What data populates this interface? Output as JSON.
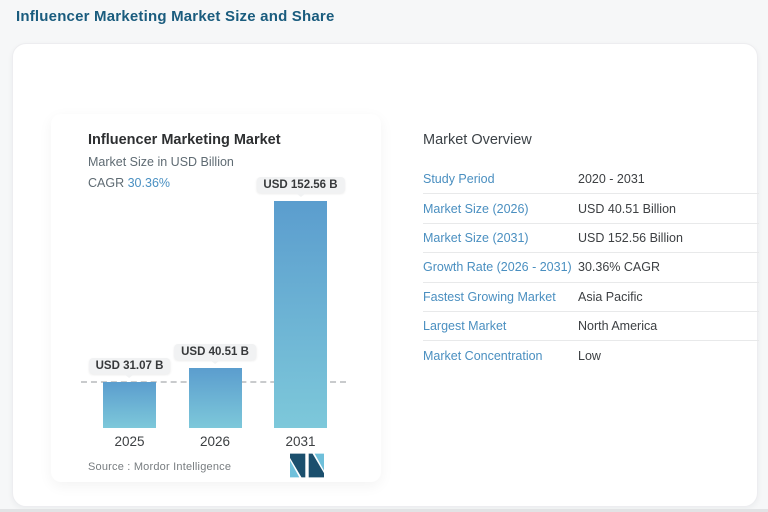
{
  "page": {
    "title": "Influencer Marketing Market Size and Share"
  },
  "colors": {
    "accent_heading": "#1a5c7e",
    "link_blue": "#4a8fc0",
    "cagr_blue": "#4a90c2",
    "bar_top": "#5b9dce",
    "bar_bottom": "#7dc8da",
    "logo_dark": "#1b4f6d",
    "logo_light": "#6fc0db"
  },
  "chart": {
    "title": "Influencer Marketing Market",
    "subtitle": "Market Size in USD Billion",
    "cagr_label": "CAGR",
    "cagr_value": "30.36%",
    "source_text": "Source :  Mordor Intelligence"
  },
  "chart_data": {
    "type": "bar",
    "title": "Influencer Marketing Market",
    "subtitle": "Market Size in USD Billion",
    "categories": [
      "2025",
      "2026",
      "2031"
    ],
    "values": [
      31.07,
      40.51,
      152.56
    ],
    "bar_labels": [
      "USD 31.07 B",
      "USD 40.51 B",
      "USD 152.56 B"
    ],
    "xlabel": "",
    "ylabel": "Market Size in USD Billion",
    "ylim": [
      0,
      160
    ],
    "reference_dashed_line_at": 31.07,
    "grid": false,
    "legend": false,
    "cagr": "30.36%"
  },
  "overview": {
    "title": "Market Overview",
    "rows": [
      {
        "label": "Study Period",
        "value": "2020 - 2031"
      },
      {
        "label": "Market Size (2026)",
        "value": "USD 40.51 Billion"
      },
      {
        "label": "Market Size (2031)",
        "value": "USD 152.56 Billion"
      },
      {
        "label": "Growth Rate (2026 - 2031)",
        "value": "30.36% CAGR"
      },
      {
        "label": "Fastest Growing Market",
        "value": "Asia Pacific"
      },
      {
        "label": "Largest Market",
        "value": "North America"
      },
      {
        "label": "Market Concentration",
        "value": "Low"
      }
    ]
  }
}
